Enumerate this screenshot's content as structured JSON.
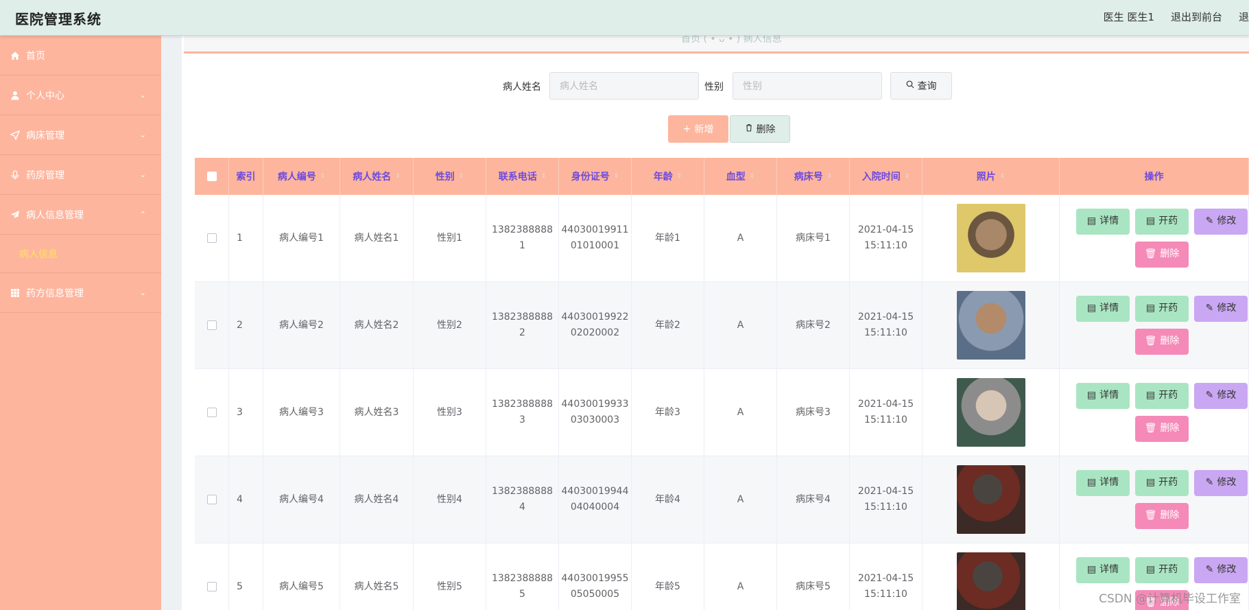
{
  "header": {
    "title": "医院管理系统",
    "user": "医生 医生1",
    "exit_front": "退出到前台",
    "logout": "退"
  },
  "sidebar": {
    "items": [
      {
        "label": "首页",
        "icon": "home-icon"
      },
      {
        "label": "个人中心",
        "icon": "user-icon"
      },
      {
        "label": "病床管理",
        "icon": "send-icon"
      },
      {
        "label": "药房管理",
        "icon": "microphone-icon"
      },
      {
        "label": "病人信息管理",
        "icon": "paper-plane-icon"
      },
      {
        "label": "药方信息管理",
        "icon": "grid-icon"
      }
    ],
    "sub_item": "病人信息"
  },
  "breadcrumb": {
    "text": "首页 ( • ᴗ • ) 病人信息"
  },
  "search": {
    "name_label": "病人姓名",
    "name_placeholder": "病人姓名",
    "gender_label": "性别",
    "gender_placeholder": "性别",
    "query_label": "查询"
  },
  "actions": {
    "add_label": "新增",
    "delete_label": "删除"
  },
  "table": {
    "headers": [
      "索引",
      "病人编号",
      "病人姓名",
      "性别",
      "联系电话",
      "身份证号",
      "年龄",
      "血型",
      "病床号",
      "入院时间",
      "照片",
      "操作"
    ],
    "rows": [
      {
        "index": "1",
        "pid": "病人编号1",
        "name": "病人姓名1",
        "gender": "性别1",
        "phone_a": "1382388888",
        "phone_b": "1",
        "id_a": "44030019911",
        "id_b": "01010001",
        "age": "年龄1",
        "blood": "A",
        "bed": "病床号1",
        "date": "2021-04-15",
        "time": "15:11:10"
      },
      {
        "index": "2",
        "pid": "病人编号2",
        "name": "病人姓名2",
        "gender": "性别2",
        "phone_a": "1382388888",
        "phone_b": "2",
        "id_a": "44030019922",
        "id_b": "02020002",
        "age": "年龄2",
        "blood": "A",
        "bed": "病床号2",
        "date": "2021-04-15",
        "time": "15:11:10"
      },
      {
        "index": "3",
        "pid": "病人编号3",
        "name": "病人姓名3",
        "gender": "性别3",
        "phone_a": "1382388888",
        "phone_b": "3",
        "id_a": "44030019933",
        "id_b": "03030003",
        "age": "年龄3",
        "blood": "A",
        "bed": "病床号3",
        "date": "2021-04-15",
        "time": "15:11:10"
      },
      {
        "index": "4",
        "pid": "病人编号4",
        "name": "病人姓名4",
        "gender": "性别4",
        "phone_a": "1382388888",
        "phone_b": "4",
        "id_a": "44030019944",
        "id_b": "04040004",
        "age": "年龄4",
        "blood": "A",
        "bed": "病床号4",
        "date": "2021-04-15",
        "time": "15:11:10"
      },
      {
        "index": "5",
        "pid": "病人编号5",
        "name": "病人姓名5",
        "gender": "性别5",
        "phone_a": "1382388888",
        "phone_b": "5",
        "id_a": "44030019955",
        "id_b": "05050005",
        "age": "年龄5",
        "blood": "A",
        "bed": "病床号5",
        "date": "2021-04-15",
        "time": "15:11:10"
      }
    ],
    "op_detail": "详情",
    "op_med": "开药",
    "op_edit": "修改",
    "op_delete": "删除"
  },
  "watermark": "CSDN @计算机毕设工作室"
}
